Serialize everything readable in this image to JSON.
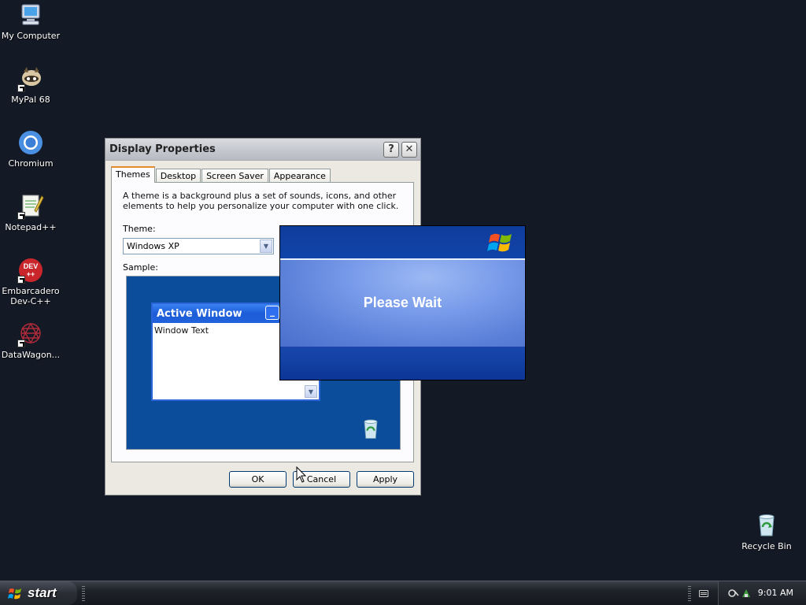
{
  "desktop": {
    "icons": [
      {
        "label": "My Computer",
        "icon": "computer-icon"
      },
      {
        "label": "MyPal 68",
        "icon": "raccoon-icon"
      },
      {
        "label": "Chromium",
        "icon": "chromium-icon"
      },
      {
        "label": "Notepad++",
        "icon": "notepad-icon"
      },
      {
        "label": "Embarcadero Dev-C++",
        "icon": "devcpp-icon",
        "badge_top": "DEV",
        "badge_bottom": "++"
      },
      {
        "label": "DataWagon...",
        "icon": "datawagon-icon"
      },
      {
        "label": "Recycle Bin",
        "icon": "recycle-bin-icon"
      }
    ]
  },
  "display_properties": {
    "title": "Display Properties",
    "help_button": "?",
    "close_button": "✕",
    "tabs": [
      "Themes",
      "Desktop",
      "Screen Saver",
      "Appearance"
    ],
    "active_tab": "Themes",
    "description": "A theme is a background plus a set of sounds, icons, and other elements to help you personalize your computer with one click.",
    "theme_label": "Theme:",
    "theme_value": "Windows XP",
    "sample_label": "Sample:",
    "sample": {
      "active_window_title": "Active Window",
      "window_text": "Window Text",
      "minimize_glyph": "_",
      "scroll_glyph": "▼"
    },
    "buttons": {
      "ok": "OK",
      "cancel": "Cancel",
      "apply": "Apply"
    }
  },
  "splash": {
    "text": "Please Wait"
  },
  "taskbar": {
    "start_label": "start",
    "clock": "9:01 AM"
  },
  "colors": {
    "desktop_bg": "#141a25",
    "splash_blue": "#0c3aa0",
    "active_title_blue": "#1c5cd8",
    "tab_accent": "#e68b2c"
  }
}
